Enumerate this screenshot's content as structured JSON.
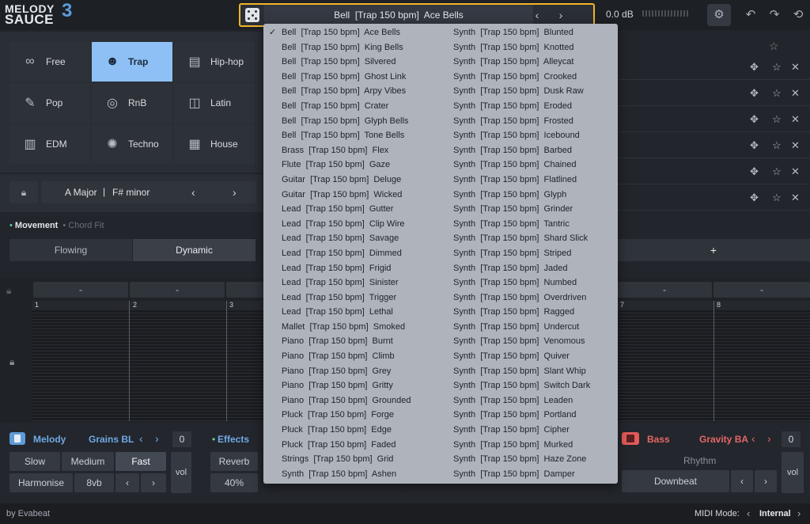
{
  "app": {
    "logo_line1": "MELODY",
    "logo_line2": "SAUCE",
    "logo_version": "3"
  },
  "header": {
    "preset": "Bell  [Trap 150 bpm]  Ace Bells",
    "prev": "‹",
    "next": "›",
    "volume": "0.0 dB",
    "icons": [
      "dice-icon",
      "gear-icon",
      "undo-icon",
      "redo-icon",
      "history-icon"
    ]
  },
  "genres": [
    {
      "label": "Free",
      "icon": "∞"
    },
    {
      "label": "Trap",
      "icon": "☻"
    },
    {
      "label": "Hip-hop",
      "icon": "▤"
    },
    {
      "label": "Pop",
      "icon": "✎"
    },
    {
      "label": "RnB",
      "icon": "◎"
    },
    {
      "label": "Latin",
      "icon": "◫"
    },
    {
      "label": "EDM",
      "icon": "▥"
    },
    {
      "label": "Techno",
      "icon": "✺"
    },
    {
      "label": "House",
      "icon": "▦"
    }
  ],
  "key": {
    "major": "A Major",
    "minor": "F# minor"
  },
  "movement": {
    "tab1": "Movement",
    "tab2": "Chord Fit",
    "opt1": "Flowing",
    "opt2": "Dynamic",
    "plus": "+"
  },
  "bars": {
    "dash": "-",
    "n1": "1",
    "n2": "2",
    "n3": "3",
    "n7": "7",
    "n8": "8"
  },
  "melody": {
    "title": "Melody",
    "preset": "Grains BL",
    "value": "0",
    "slow": "Slow",
    "medium": "Medium",
    "fast": "Fast",
    "vol": "vol",
    "harmonise": "Harmonise",
    "octave": "8vb"
  },
  "effects": {
    "title": "Effects",
    "reverb": "Reverb",
    "reverb_value": "40%"
  },
  "bass": {
    "title": "Bass",
    "preset": "Gravity BA",
    "value": "0",
    "rhythm": "Rhythm",
    "downbeat": "Downbeat",
    "vol": "vol"
  },
  "footer": {
    "brand": "by Evabeat",
    "midi_label": "MIDI Mode:",
    "midi_value": "Internal"
  },
  "dropdown": {
    "col1": [
      "Bell  [Trap 150 bpm]  Ace Bells",
      "Bell  [Trap 150 bpm]  King Bells",
      "Bell  [Trap 150 bpm]  Silvered",
      "Bell  [Trap 150 bpm]  Ghost Link",
      "Bell  [Trap 150 bpm]  Arpy Vibes",
      "Bell  [Trap 150 bpm]  Crater",
      "Bell  [Trap 150 bpm]  Glyph Bells",
      "Bell  [Trap 150 bpm]  Tone Bells",
      "Brass  [Trap 150 bpm]  Flex",
      "Flute  [Trap 150 bpm]  Gaze",
      "Guitar  [Trap 150 bpm]  Deluge",
      "Guitar  [Trap 150 bpm]  Wicked",
      "Lead  [Trap 150 bpm]  Gutter",
      "Lead  [Trap 150 bpm]  Clip Wire",
      "Lead  [Trap 150 bpm]  Savage",
      "Lead  [Trap 150 bpm]  Dimmed",
      "Lead  [Trap 150 bpm]  Frigid",
      "Lead  [Trap 150 bpm]  Sinister",
      "Lead  [Trap 150 bpm]  Trigger",
      "Lead  [Trap 150 bpm]  Lethal",
      "Mallet  [Trap 150 bpm]  Smoked",
      "Piano  [Trap 150 bpm]  Burnt",
      "Piano  [Trap 150 bpm]  Climb",
      "Piano  [Trap 150 bpm]  Grey",
      "Piano  [Trap 150 bpm]  Gritty",
      "Piano  [Trap 150 bpm]  Grounded",
      "Pluck  [Trap 150 bpm]  Forge",
      "Pluck  [Trap 150 bpm]  Edge",
      "Pluck  [Trap 150 bpm]  Faded",
      "Strings  [Trap 150 bpm]  Grid",
      "Synth  [Trap 150 bpm]  Ashen"
    ],
    "col2": [
      "Synth  [Trap 150 bpm]  Blunted",
      "Synth  [Trap 150 bpm]  Knotted",
      "Synth  [Trap 150 bpm]  Alleycat",
      "Synth  [Trap 150 bpm]  Crooked",
      "Synth  [Trap 150 bpm]  Dusk Raw",
      "Synth  [Trap 150 bpm]  Eroded",
      "Synth  [Trap 150 bpm]  Frosted",
      "Synth  [Trap 150 bpm]  Icebound",
      "Synth  [Trap 150 bpm]  Barbed",
      "Synth  [Trap 150 bpm]  Chained",
      "Synth  [Trap 150 bpm]  Flatlined",
      "Synth  [Trap 150 bpm]  Glyph",
      "Synth  [Trap 150 bpm]  Grinder",
      "Synth  [Trap 150 bpm]  Tantric",
      "Synth  [Trap 150 bpm]  Shard Slick",
      "Synth  [Trap 150 bpm]  Striped",
      "Synth  [Trap 150 bpm]  Jaded",
      "Synth  [Trap 150 bpm]  Numbed",
      "Synth  [Trap 150 bpm]  Overdriven",
      "Synth  [Trap 150 bpm]  Ragged",
      "Synth  [Trap 150 bpm]  Undercut",
      "Synth  [Trap 150 bpm]  Venomous",
      "Synth  [Trap 150 bpm]  Quiver",
      "Synth  [Trap 150 bpm]  Slant Whip",
      "Synth  [Trap 150 bpm]  Switch Dark",
      "Synth  [Trap 150 bpm]  Leaden",
      "Synth  [Trap 150 bpm]  Portland",
      "Synth  [Trap 150 bpm]  Cipher",
      "Synth  [Trap 150 bpm]  Murked",
      "Synth  [Trap 150 bpm]  Haze Zone",
      "Synth  [Trap 150 bpm]  Damper"
    ],
    "checkmark": "✓"
  },
  "colors": {
    "accent": "#8ec0f5",
    "highlight": "#f0b429",
    "bass": "#e35a5a",
    "melody": "#5f9bd8"
  }
}
